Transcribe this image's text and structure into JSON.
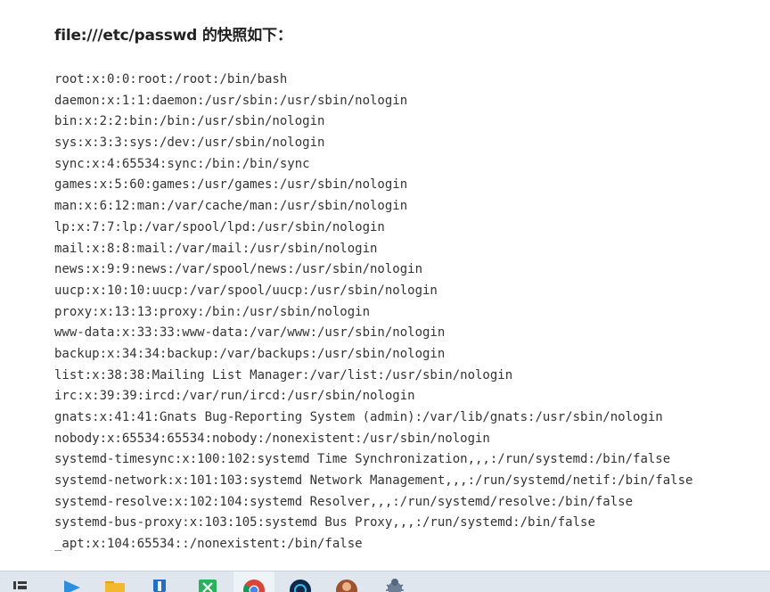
{
  "heading": "file:///etc/passwd 的快照如下：",
  "lines": [
    "root:x:0:0:root:/root:/bin/bash",
    "daemon:x:1:1:daemon:/usr/sbin:/usr/sbin/nologin",
    "bin:x:2:2:bin:/bin:/usr/sbin/nologin",
    "sys:x:3:3:sys:/dev:/usr/sbin/nologin",
    "sync:x:4:65534:sync:/bin:/bin/sync",
    "games:x:5:60:games:/usr/games:/usr/sbin/nologin",
    "man:x:6:12:man:/var/cache/man:/usr/sbin/nologin",
    "lp:x:7:7:lp:/var/spool/lpd:/usr/sbin/nologin",
    "mail:x:8:8:mail:/var/mail:/usr/sbin/nologin",
    "news:x:9:9:news:/var/spool/news:/usr/sbin/nologin",
    "uucp:x:10:10:uucp:/var/spool/uucp:/usr/sbin/nologin",
    "proxy:x:13:13:proxy:/bin:/usr/sbin/nologin",
    "www-data:x:33:33:www-data:/var/www:/usr/sbin/nologin",
    "backup:x:34:34:backup:/var/backups:/usr/sbin/nologin",
    "list:x:38:38:Mailing List Manager:/var/list:/usr/sbin/nologin",
    "irc:x:39:39:ircd:/var/run/ircd:/usr/sbin/nologin",
    "gnats:x:41:41:Gnats Bug-Reporting System (admin):/var/lib/gnats:/usr/sbin/nologin",
    "nobody:x:65534:65534:nobody:/nonexistent:/usr/sbin/nologin",
    "systemd-timesync:x:100:102:systemd Time Synchronization,,,:/run/systemd:/bin/false",
    "systemd-network:x:101:103:systemd Network Management,,,:/run/systemd/netif:/bin/false",
    "systemd-resolve:x:102:104:systemd Resolver,,,:/run/systemd/resolve:/bin/false",
    "systemd-bus-proxy:x:103:105:systemd Bus Proxy,,,:/run/systemd:/bin/false",
    "_apt:x:104:65534::/nonexistent:/bin/false"
  ],
  "taskbar": {
    "apps": [
      {
        "icon": "task-view-icon",
        "color": "#3a3a3a"
      },
      {
        "icon": "media-player-icon",
        "color": "#2b8fe0"
      },
      {
        "icon": "file-explorer-icon",
        "color": "#f2b92e"
      },
      {
        "icon": "security-shield-icon",
        "color": "#1f6fd1"
      },
      {
        "icon": "green-app-icon",
        "color": "#26b35a"
      },
      {
        "icon": "chrome-icon",
        "color": "#db4437"
      },
      {
        "icon": "dark-circle-app-icon",
        "color": "#0b2a4a"
      },
      {
        "icon": "avatar-app-icon",
        "color": "#a0522d"
      },
      {
        "icon": "bug-app-icon",
        "color": "#6c7f95"
      }
    ]
  }
}
